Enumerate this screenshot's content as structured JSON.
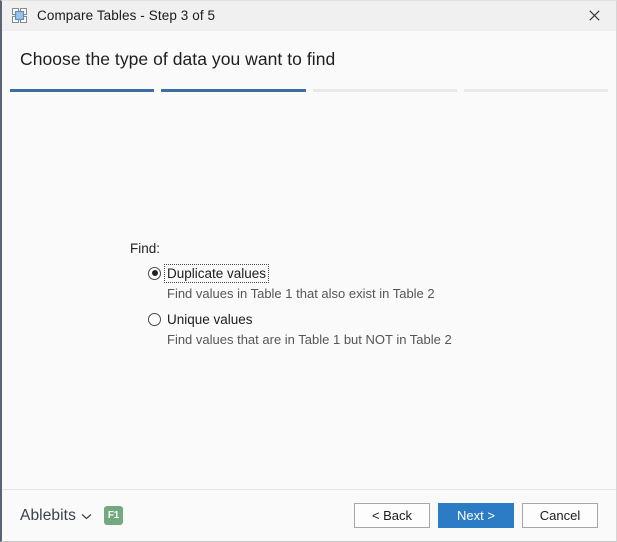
{
  "window": {
    "title": "Compare Tables - Step 3 of 5",
    "icon": "compare-tables-icon",
    "close_icon": "close-icon"
  },
  "header": {
    "title": "Choose the type of data you want to find"
  },
  "progress": {
    "total_steps": 4,
    "current_step": 2,
    "done_color": "#3b6ea5",
    "todo_color": "#e8e8e8",
    "steps": [
      {
        "state": "done"
      },
      {
        "state": "done"
      },
      {
        "state": "todo"
      },
      {
        "state": "todo"
      }
    ]
  },
  "main": {
    "group_label": "Find:",
    "options": [
      {
        "label": "Duplicate values",
        "description": "Find values in Table 1 that also exist in Table 2",
        "selected": true,
        "focused": true
      },
      {
        "label": "Unique values",
        "description": "Find values that are in Table 1 but NOT in Table 2",
        "selected": false,
        "focused": false
      }
    ]
  },
  "footer": {
    "brand": "Ablebits",
    "brand_chevron_icon": "chevron-down-icon",
    "help_badge": "F1",
    "help_badge_color": "#72a97e",
    "buttons": {
      "back": "< Back",
      "next": "Next >",
      "cancel": "Cancel",
      "primary_color": "#2b7cc4"
    }
  }
}
